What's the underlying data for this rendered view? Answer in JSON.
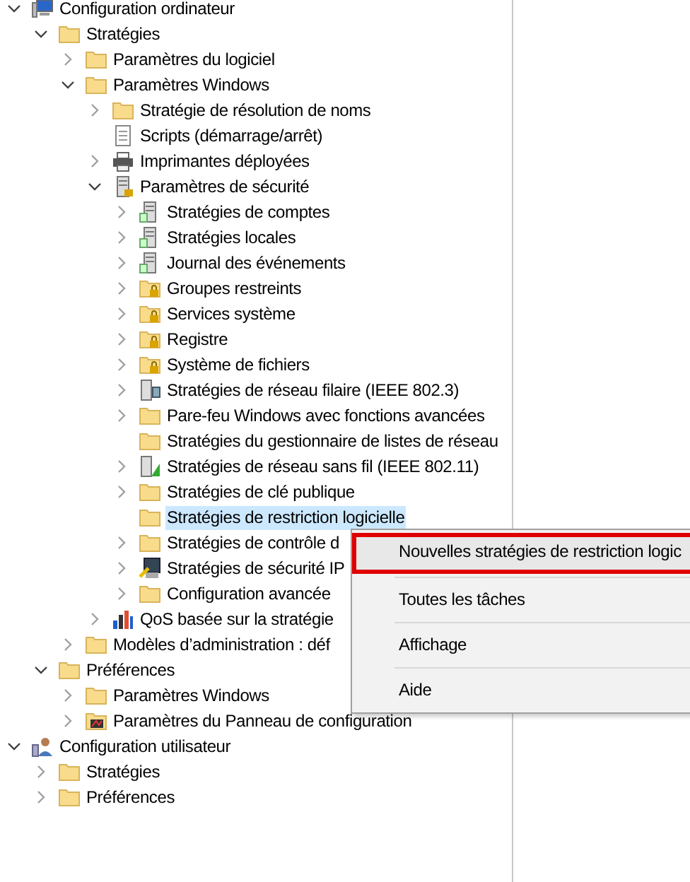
{
  "tree": [
    {
      "label": "Configuration ordinateur",
      "kind": "computer",
      "has_children": true,
      "expanded": true,
      "selected": false,
      "children": [
        {
          "label": "Stratégies",
          "kind": "folder",
          "has_children": true,
          "expanded": true,
          "selected": false,
          "children": [
            {
              "label": "Paramètres du logiciel",
              "kind": "folder",
              "has_children": true,
              "expanded": false,
              "selected": false
            },
            {
              "label": "Paramètres Windows",
              "kind": "folder",
              "has_children": true,
              "expanded": true,
              "selected": false,
              "children": [
                {
                  "label": "Stratégie de résolution de noms",
                  "kind": "folder",
                  "has_children": true,
                  "expanded": false,
                  "selected": false
                },
                {
                  "label": "Scripts (démarrage/arrêt)",
                  "kind": "script",
                  "has_children": false,
                  "expanded": false,
                  "selected": false
                },
                {
                  "label": "Imprimantes déployées",
                  "kind": "printer",
                  "has_children": true,
                  "expanded": false,
                  "selected": false
                },
                {
                  "label": "Paramètres de sécurité",
                  "kind": "secure-server",
                  "has_children": true,
                  "expanded": true,
                  "selected": false,
                  "children": [
                    {
                      "label": "Stratégies de comptes",
                      "kind": "server",
                      "has_children": true,
                      "expanded": false,
                      "selected": false
                    },
                    {
                      "label": "Stratégies locales",
                      "kind": "server",
                      "has_children": true,
                      "expanded": false,
                      "selected": false
                    },
                    {
                      "label": "Journal des événements",
                      "kind": "server",
                      "has_children": true,
                      "expanded": false,
                      "selected": false
                    },
                    {
                      "label": "Groupes restreints",
                      "kind": "lock-folder",
                      "has_children": true,
                      "expanded": false,
                      "selected": false
                    },
                    {
                      "label": "Services système",
                      "kind": "lock-folder",
                      "has_children": true,
                      "expanded": false,
                      "selected": false
                    },
                    {
                      "label": "Registre",
                      "kind": "lock-folder",
                      "has_children": true,
                      "expanded": false,
                      "selected": false
                    },
                    {
                      "label": "Système de fichiers",
                      "kind": "lock-folder",
                      "has_children": true,
                      "expanded": false,
                      "selected": false
                    },
                    {
                      "label": "Stratégies de réseau filaire (IEEE 802.3)",
                      "kind": "network",
                      "has_children": true,
                      "expanded": false,
                      "selected": false
                    },
                    {
                      "label": "Pare-feu Windows avec fonctions avancées",
                      "kind": "folder",
                      "has_children": true,
                      "expanded": false,
                      "selected": false
                    },
                    {
                      "label": "Stratégies du gestionnaire de listes de réseau",
                      "kind": "folder",
                      "has_children": false,
                      "expanded": false,
                      "selected": false
                    },
                    {
                      "label": "Stratégies de réseau sans fil (IEEE 802.11)",
                      "kind": "wifi",
                      "has_children": true,
                      "expanded": false,
                      "selected": false
                    },
                    {
                      "label": "Stratégies de clé publique",
                      "kind": "folder",
                      "has_children": true,
                      "expanded": false,
                      "selected": false
                    },
                    {
                      "label": "Stratégies de restriction logicielle",
                      "kind": "folder",
                      "has_children": false,
                      "expanded": false,
                      "selected": true
                    },
                    {
                      "label": "Stratégies de contrôle d",
                      "kind": "folder",
                      "has_children": true,
                      "expanded": false,
                      "selected": false
                    },
                    {
                      "label": "Stratégies de sécurité IP",
                      "kind": "ipsec",
                      "has_children": true,
                      "expanded": false,
                      "selected": false
                    },
                    {
                      "label": "Configuration avancée",
                      "kind": "folder",
                      "has_children": true,
                      "expanded": false,
                      "selected": false
                    }
                  ]
                },
                {
                  "label": "QoS basée sur la stratégie",
                  "kind": "chart",
                  "has_children": true,
                  "expanded": false,
                  "selected": false
                }
              ]
            },
            {
              "label": "Modèles d’administration : déf",
              "kind": "folder",
              "has_children": true,
              "expanded": false,
              "selected": false
            }
          ]
        },
        {
          "label": "Préférences",
          "kind": "folder",
          "has_children": true,
          "expanded": true,
          "selected": false,
          "children": [
            {
              "label": "Paramètres Windows",
              "kind": "folder",
              "has_children": true,
              "expanded": false,
              "selected": false
            },
            {
              "label": "Paramètres du Panneau de configuration",
              "kind": "control-panel",
              "has_children": true,
              "expanded": false,
              "selected": false
            }
          ]
        }
      ]
    },
    {
      "label": "Configuration utilisateur",
      "kind": "user",
      "has_children": true,
      "expanded": true,
      "selected": false,
      "children": [
        {
          "label": "Stratégies",
          "kind": "folder",
          "has_children": true,
          "expanded": false,
          "selected": false
        },
        {
          "label": "Préférences",
          "kind": "folder",
          "has_children": true,
          "expanded": false,
          "selected": false
        }
      ]
    }
  ],
  "context_menu": [
    {
      "label": "Nouvelles stratégies de restriction logic",
      "highlighted": true
    },
    {
      "label": "Toutes les tâches",
      "highlighted": false
    },
    {
      "label": "Affichage",
      "highlighted": false
    },
    {
      "label": "Aide",
      "highlighted": false
    }
  ]
}
